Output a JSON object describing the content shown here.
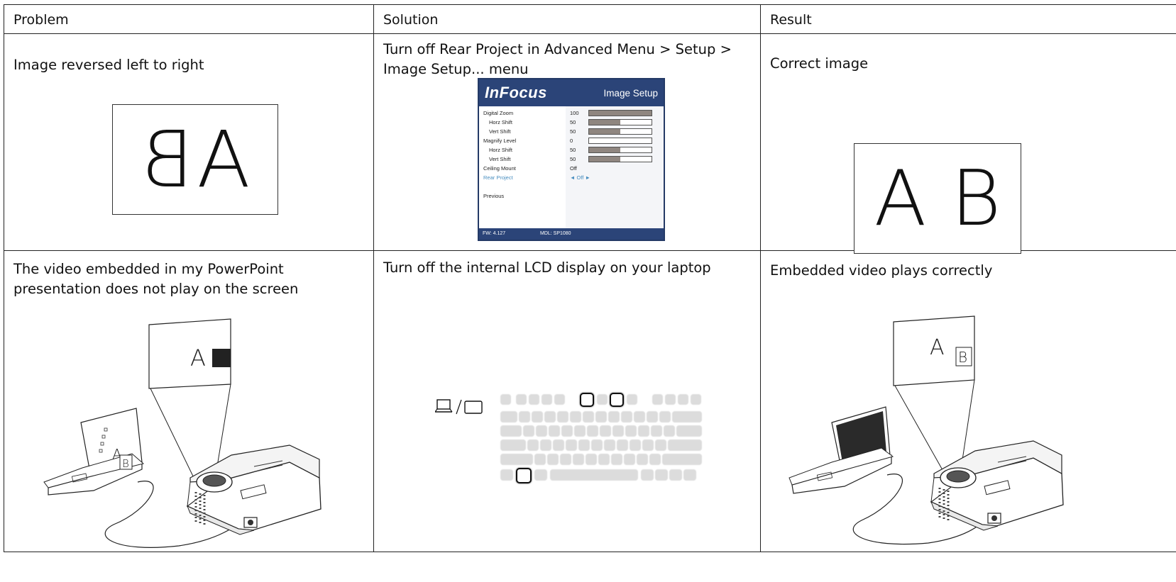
{
  "headers": {
    "problem": "Problem",
    "solution": "Solution",
    "result": "Result"
  },
  "rows": [
    {
      "problem": "Image reversed left to right",
      "problem_image_text": "AB",
      "solution": "Turn off Rear Project in Advanced Menu > Setup > Image Setup... menu",
      "result": "Correct image",
      "result_image_text": "A B"
    },
    {
      "problem": "The video embedded in my PowerPoint presentation does not play on the screen",
      "solution": "Turn off the internal LCD display on your laptop",
      "result": "Embedded video plays correctly"
    }
  ],
  "osd": {
    "logo": "InFocus",
    "title": "Image Setup",
    "items": [
      {
        "label": "Digital Zoom",
        "value": "100",
        "bar": 1.0
      },
      {
        "label": "Horz Shift",
        "value": "50",
        "bar": 0.5
      },
      {
        "label": "Vert Shift",
        "value": "50",
        "bar": 0.5
      },
      {
        "label": "Magnify Level",
        "value": "0",
        "bar": 0.0
      },
      {
        "label": "Horz Shift",
        "value": "50",
        "bar": 0.5
      },
      {
        "label": "Vert Shift",
        "value": "50",
        "bar": 0.5
      },
      {
        "label": "Ceiling Mount",
        "value": "Off"
      },
      {
        "label": "Rear Project",
        "value": "◄ Off ►",
        "highlight": true
      },
      {
        "label": "Previous",
        "value": ""
      }
    ],
    "fw": "FW: 4.127",
    "mdl": "MDL: SP1080",
    "highlight_color": "#4a8fc0",
    "brand_color": "#2b4478"
  },
  "illustrations": {
    "problem_screen_text_a": "A",
    "laptop_screen_text_a": "A",
    "laptop_screen_text_b": "B",
    "result_screen_text_a": "A",
    "result_screen_text_b": "B"
  },
  "icons": {
    "display_toggle": "laptop-monitor-icon",
    "keyboard": "keyboard-icon"
  }
}
